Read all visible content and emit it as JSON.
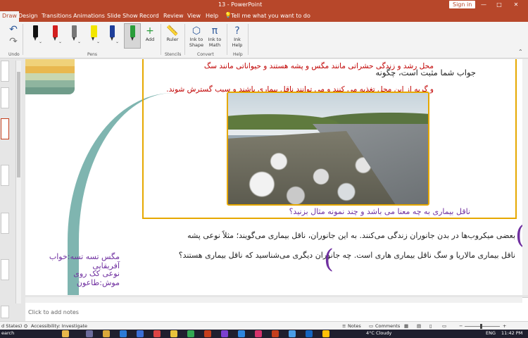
{
  "titlebar": {
    "title": "13 - PowerPoint",
    "signin": "Sign in",
    "min_glyph": "—",
    "max_glyph": "□",
    "close_glyph": "✕"
  },
  "tabs": {
    "items": [
      "Draw",
      "Design",
      "Transitions",
      "Animations",
      "Slide Show",
      "Record",
      "Review",
      "View",
      "Help"
    ],
    "active": "Draw",
    "tellme": "Tell me what you want to do",
    "tellme_icon": "lightbulb-icon"
  },
  "ribbon": {
    "groups": {
      "undo": "Undo",
      "pens": "Pens",
      "stencils": "Stencils",
      "convert": "Convert",
      "help": "Help"
    },
    "add_label": "Add",
    "ruler_label": "Ruler",
    "ink_to_shape": "Ink to Shape",
    "ink_to_math": "Ink to Math",
    "ink_help": "Ink Help",
    "pen_colors": [
      "#111111",
      "#d22020",
      "#555555",
      "#f2e600",
      "#1f3f9a",
      "#2a9d3a"
    ]
  },
  "slide": {
    "line_black": "جواب شما مثبت است، چگونه",
    "line_red1": "محل رشد و زندگی حشراتی مانند مگس و پشه هستند و حیواناتی مانند سگ",
    "line_red2": "و گربه از این محل تغذیه می کنند و می توانند ناقل بیماری باشند و سبب گسترش شوند.",
    "line_purple_q": "ناقل بیماری به چه معنا می باشد و چند نمونه مثال بزنید؟",
    "bottom1": "بعضی میکروب‌ها در بدن جانوران زندگی می‌کنند. به این جانوران، ناقل بیماری می‌گویند؛ مثلاً نوعی پشه",
    "bottom2": "ناقل بیماری مالاریا و سگ ناقل بیماری هاری است. چه جانوران دیگری می‌شناسید که ناقل بیماری هستند؟",
    "left1": "مگس تسه تسه:خواب آفریقایی",
    "left2": "نوعی کک روی موش:طاعون"
  },
  "notes": {
    "placeholder": "Click to add notes"
  },
  "statusbar": {
    "lang": "d States)",
    "accessibility": "Accessibility: Investigate",
    "notes": "Notes",
    "comments": "Comments"
  },
  "taskbar": {
    "search": "earch",
    "weather": "4°C Cloudy",
    "lang": "ENG",
    "time": "11:42 PM"
  }
}
